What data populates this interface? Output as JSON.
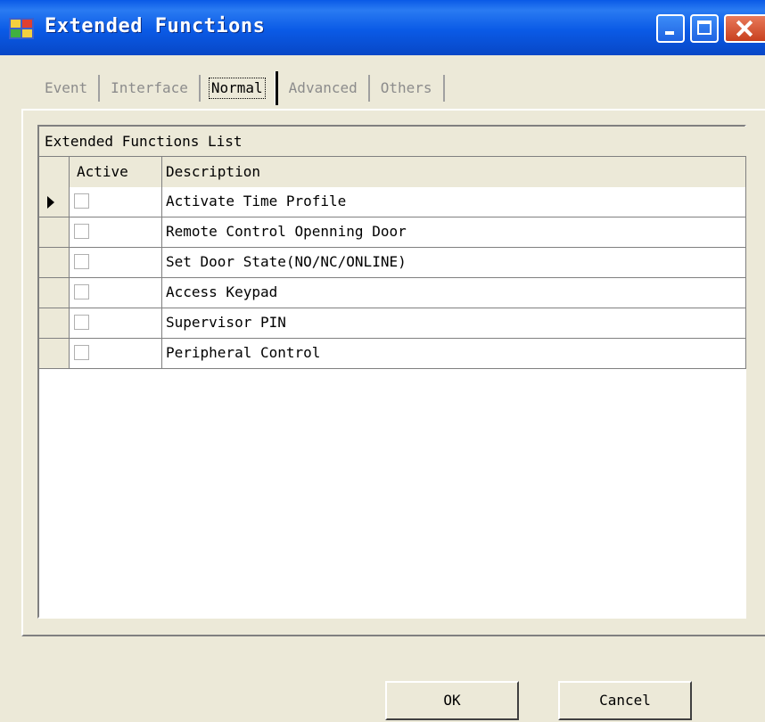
{
  "window": {
    "title": "Extended Functions",
    "icon": "app-window-icon",
    "controls": [
      "minimize-icon",
      "maximize-icon",
      "close-icon"
    ]
  },
  "tabs": [
    {
      "label": "Event",
      "active": false
    },
    {
      "label": "Interface",
      "active": false
    },
    {
      "label": "Normal",
      "active": true
    },
    {
      "label": "Advanced",
      "active": false
    },
    {
      "label": "Others",
      "active": false
    }
  ],
  "grid": {
    "caption": "Extended Functions List",
    "columns": {
      "active": "Active",
      "description": "Description"
    },
    "rows": [
      {
        "active": false,
        "description": "Activate Time Profile",
        "current": true
      },
      {
        "active": false,
        "description": "Remote Control Openning Door",
        "current": false
      },
      {
        "active": false,
        "description": "Set Door State(NO/NC/ONLINE)",
        "current": false
      },
      {
        "active": false,
        "description": "Access Keypad",
        "current": false
      },
      {
        "active": false,
        "description": "Supervisor PIN",
        "current": false
      },
      {
        "active": false,
        "description": "Peripheral Control",
        "current": false
      }
    ]
  },
  "buttons": {
    "ok": "OK",
    "cancel": "Cancel"
  },
  "colors": {
    "titlebar": "#0a5ae6",
    "face": "#ece9d8",
    "close": "#c8401f"
  }
}
